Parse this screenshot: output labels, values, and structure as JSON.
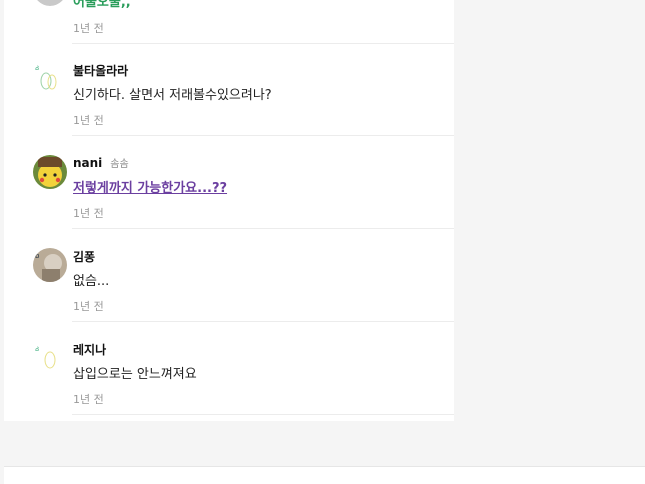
{
  "comments": [
    {
      "author": "",
      "text": "어울오울,,",
      "time": "1년 전"
    },
    {
      "author": "불타올라라",
      "text": "신기하다. 살면서 저래볼수있으려나?",
      "time": "1년 전"
    },
    {
      "author": "nani",
      "badge": "솜솜",
      "text": "저렇게까지 가능한가요...??",
      "time": "1년 전"
    },
    {
      "author": "김퐁",
      "text": "없슴...",
      "time": "1년 전"
    },
    {
      "author": "레지나",
      "text": "삽입으로는 안느껴져요",
      "time": "1년 전"
    }
  ]
}
